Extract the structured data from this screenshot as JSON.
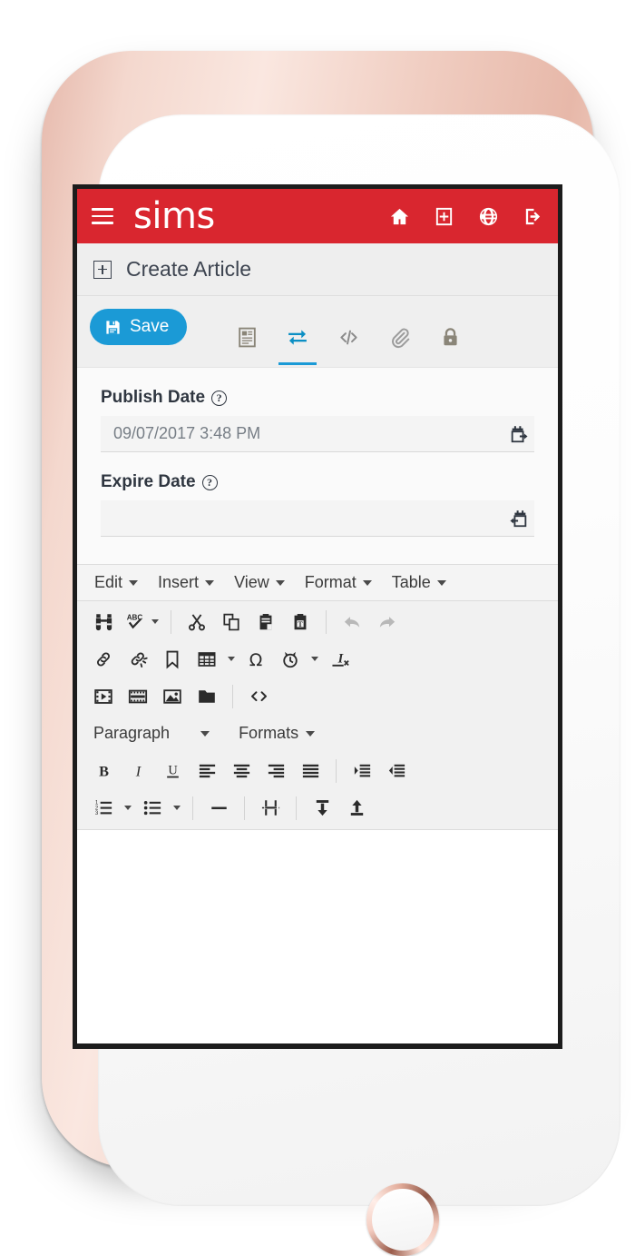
{
  "app": {
    "brand": "sims",
    "menu_icon": "hamburger-icon",
    "header_icons": [
      {
        "name": "home-icon",
        "label": "Home"
      },
      {
        "name": "add-box-icon",
        "label": "New"
      },
      {
        "name": "globe-icon",
        "label": "Language"
      },
      {
        "name": "logout-icon",
        "label": "Log out"
      }
    ],
    "accent_red": "#d9262f",
    "accent_blue": "#1b9ad6"
  },
  "page": {
    "title": "Create Article",
    "title_icon": "add-box-icon"
  },
  "toolbar": {
    "save_label": "Save",
    "save_icon": "floppy-disk-icon",
    "tabs": [
      {
        "name": "tab-details",
        "icon": "article-details-icon",
        "label": "Details",
        "active": false
      },
      {
        "name": "tab-publishing",
        "icon": "transfer-arrows-icon",
        "label": "Publishing",
        "active": true
      },
      {
        "name": "tab-source",
        "icon": "code-icon",
        "label": "Source",
        "active": false
      },
      {
        "name": "tab-attachments",
        "icon": "paperclip-icon",
        "label": "Attachments",
        "active": false
      },
      {
        "name": "tab-permissions",
        "icon": "lock-icon",
        "label": "Permissions",
        "active": false
      }
    ]
  },
  "form": {
    "fields": [
      {
        "name": "publish-date",
        "label": "Publish Date",
        "help": "?",
        "value": "09/07/2017 3:48 PM",
        "placeholder": "",
        "icon": "calendar-start-icon"
      },
      {
        "name": "expire-date",
        "label": "Expire Date",
        "help": "?",
        "value": "",
        "placeholder": "",
        "icon": "calendar-end-icon"
      }
    ]
  },
  "editor": {
    "menus": [
      {
        "name": "menu-edit",
        "label": "Edit"
      },
      {
        "name": "menu-insert",
        "label": "Insert"
      },
      {
        "name": "menu-view",
        "label": "View"
      },
      {
        "name": "menu-format",
        "label": "Format"
      },
      {
        "name": "menu-table",
        "label": "Table"
      }
    ],
    "style_select": {
      "name": "block-format-select",
      "value": "Paragraph"
    },
    "formats_menu": {
      "name": "formats-menu",
      "label": "Formats"
    },
    "toolbar_rows": [
      [
        {
          "name": "searchreplace-button",
          "icon": "binoculars-icon",
          "disabled": false
        },
        {
          "name": "spellchecker-button",
          "icon": "spellcheck-abc-icon",
          "disabled": false,
          "caret": true
        },
        {
          "sep": true
        },
        {
          "name": "cut-button",
          "icon": "scissors-icon",
          "disabled": false
        },
        {
          "name": "copy-button",
          "icon": "copy-icon",
          "disabled": false
        },
        {
          "name": "paste-button",
          "icon": "clipboard-icon",
          "disabled": false
        },
        {
          "name": "paste-as-text-button",
          "icon": "clipboard-text-icon",
          "disabled": false
        },
        {
          "sep": true
        },
        {
          "name": "undo-button",
          "icon": "undo-arrow-icon",
          "disabled": true
        },
        {
          "name": "redo-button",
          "icon": "redo-arrow-icon",
          "disabled": true
        }
      ],
      [
        {
          "name": "link-button",
          "icon": "chain-link-icon",
          "disabled": false
        },
        {
          "name": "unlink-button",
          "icon": "broken-link-icon",
          "disabled": false
        },
        {
          "name": "anchor-button",
          "icon": "bookmark-icon",
          "disabled": false
        },
        {
          "name": "table-button",
          "icon": "table-grid-icon",
          "disabled": false,
          "caret": true
        },
        {
          "name": "charmap-button",
          "icon": "omega-icon",
          "disabled": false
        },
        {
          "name": "insert-datetime-button",
          "icon": "clock-icon",
          "disabled": false,
          "caret": true
        },
        {
          "name": "remove-format-button",
          "icon": "clear-formatting-icon",
          "disabled": false
        }
      ],
      [
        {
          "name": "media-button",
          "icon": "film-play-icon",
          "disabled": false
        },
        {
          "name": "template-button",
          "icon": "film-strip-icon",
          "disabled": false
        },
        {
          "name": "image-button",
          "icon": "picture-icon",
          "disabled": false
        },
        {
          "name": "file-browser-button",
          "icon": "folder-icon",
          "disabled": false
        },
        {
          "sep": true
        },
        {
          "name": "source-code-button",
          "icon": "angle-brackets-icon",
          "disabled": false
        }
      ],
      [
        {
          "name": "bold-button",
          "icon": "bold-icon",
          "disabled": false
        },
        {
          "name": "italic-button",
          "icon": "italic-icon",
          "disabled": false
        },
        {
          "name": "underline-button",
          "icon": "underline-icon",
          "disabled": false
        },
        {
          "name": "align-left-button",
          "icon": "align-left-icon",
          "disabled": false
        },
        {
          "name": "align-center-button",
          "icon": "align-center-icon",
          "disabled": false
        },
        {
          "name": "align-right-button",
          "icon": "align-right-icon",
          "disabled": false
        },
        {
          "name": "align-justify-button",
          "icon": "align-justify-icon",
          "disabled": false
        },
        {
          "sep": true
        },
        {
          "name": "indent-button",
          "icon": "indent-icon",
          "disabled": false
        },
        {
          "name": "outdent-button",
          "icon": "outdent-icon",
          "disabled": false
        }
      ],
      [
        {
          "name": "numbered-list-button",
          "icon": "ordered-list-icon",
          "disabled": false,
          "caret": true
        },
        {
          "name": "bullet-list-button",
          "icon": "unordered-list-icon",
          "disabled": false,
          "caret": true
        },
        {
          "sep": true
        },
        {
          "name": "horizontal-rule-button",
          "icon": "horizontal-rule-icon",
          "disabled": false
        },
        {
          "sep": true
        },
        {
          "name": "page-break-button",
          "icon": "page-break-icon",
          "disabled": false
        },
        {
          "sep": true
        },
        {
          "name": "insert-below-button",
          "icon": "arrow-down-to-line-icon",
          "disabled": false
        },
        {
          "name": "insert-above-button",
          "icon": "arrow-up-from-line-icon",
          "disabled": false
        }
      ]
    ],
    "content": ""
  }
}
